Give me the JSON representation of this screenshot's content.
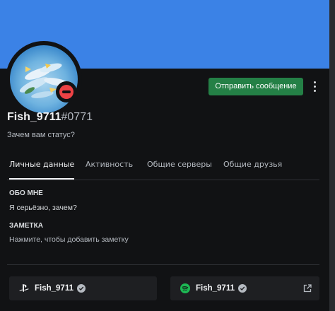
{
  "profile": {
    "username": "Fish_9711",
    "discriminator": "#0771",
    "custom_status": "Зачем вам статус?",
    "status": "dnd",
    "banner_color": "#3b82e6"
  },
  "actions": {
    "send_message_label": "Отправить сообщение"
  },
  "tabs": [
    {
      "label": "Личные данные",
      "active": true
    },
    {
      "label": "Активность",
      "active": false
    },
    {
      "label": "Общие серверы",
      "active": false
    },
    {
      "label": "Общие друзья",
      "active": false
    }
  ],
  "about": {
    "title": "ОБО МНЕ",
    "text": "Я серьёзно, зачем?"
  },
  "note": {
    "title": "ЗАМЕТКА",
    "placeholder": "Нажмите, чтобы добавить заметку"
  },
  "connections": [
    {
      "service": "playstation-icon",
      "name": "Fish_9711",
      "verified": true
    },
    {
      "service": "spotify-icon",
      "name": "Fish_9711",
      "verified": true,
      "external_link": true
    }
  ],
  "colors": {
    "accent_green": "#248046",
    "dnd_red": "#ed4245",
    "spotify_green": "#1db954"
  }
}
